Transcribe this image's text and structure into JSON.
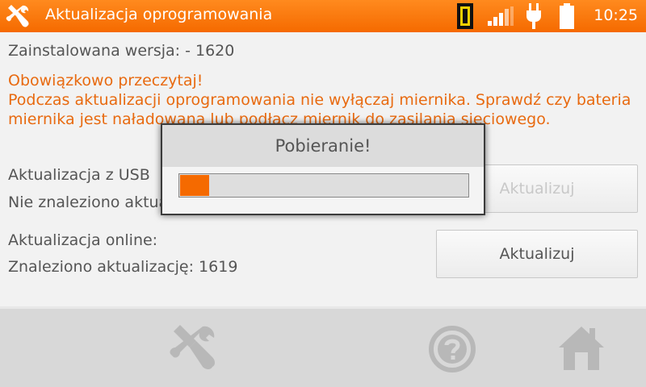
{
  "header": {
    "title": "Aktualizacja oprogramowania",
    "clock": "10:25",
    "icons": [
      "tools-icon",
      "meter-icon",
      "signal-icon",
      "plug-icon",
      "battery-icon"
    ]
  },
  "main": {
    "installed_version": "Zainstalowana wersja: - 1620",
    "warning_title": "Obowiązkowo przeczytaj!",
    "warning_text": "Podczas aktualizacji oprogramowania nie wyłączaj miernika. Sprawdź czy bateria miernika jest naładowana lub podłącz miernik do zasilania sieciowego.",
    "usb_label": "Aktualizacja z USB",
    "usb_status": "Nie znaleziono aktualizacji",
    "usb_button": "Aktualizuj",
    "online_label": "Aktualizacja online:",
    "online_status": "Znaleziono aktualizację: 1619",
    "online_button": "Aktualizuj"
  },
  "dialog": {
    "title": "Pobieranie!",
    "progress": 0.1
  },
  "bottombar": {
    "icons": [
      "tools-icon",
      "help-icon",
      "home-icon"
    ]
  },
  "colors": {
    "accent": "#f56a00",
    "warning_text": "#e86a10",
    "text": "#555555"
  }
}
